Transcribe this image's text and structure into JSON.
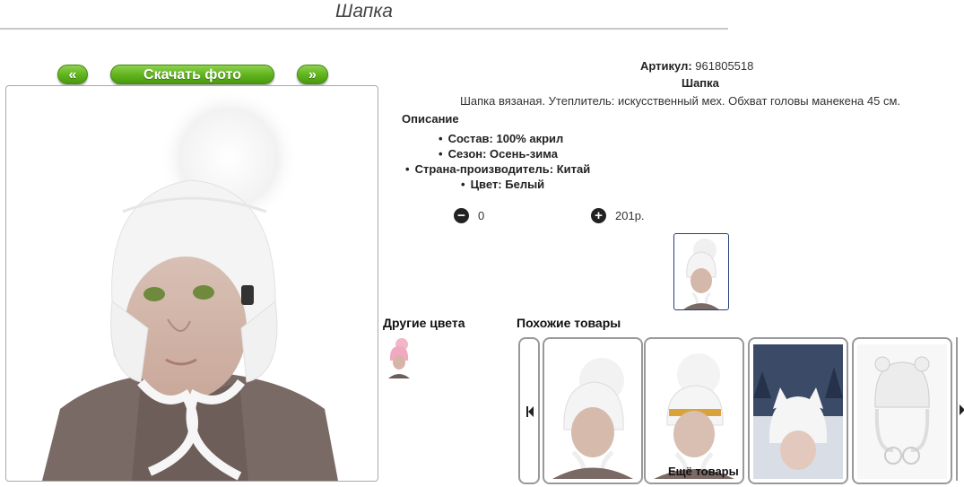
{
  "page": {
    "title": "Шапка"
  },
  "gallery": {
    "prev_label": "«",
    "download_label": "Скачать фото",
    "next_label": "»"
  },
  "product": {
    "article_label": "Артикул:",
    "article_value": "961805518",
    "name": "Шапка",
    "description": "Шапка вязаная. Утеплитель: искусственный мех. Обхват головы манекена 45 см.",
    "description_heading": "Описание",
    "attributes": [
      "Состав: 100% акрил",
      "Сезон: Осень-зима",
      "Страна-производитель: Китай",
      "Цвет: Белый"
    ],
    "quantity": "0",
    "price": "201р."
  },
  "other_colors": {
    "heading": "Другие цвета"
  },
  "similar": {
    "heading": "Похожие товары",
    "more_label": "Ещё товары"
  },
  "colors": {
    "accent_green": "#62b51f",
    "frame_gray": "#999999"
  },
  "icons": {
    "prev": "left-arrow-icon",
    "next": "right-arrow-icon",
    "minus": "minus-circle-icon",
    "plus": "plus-circle-icon"
  }
}
